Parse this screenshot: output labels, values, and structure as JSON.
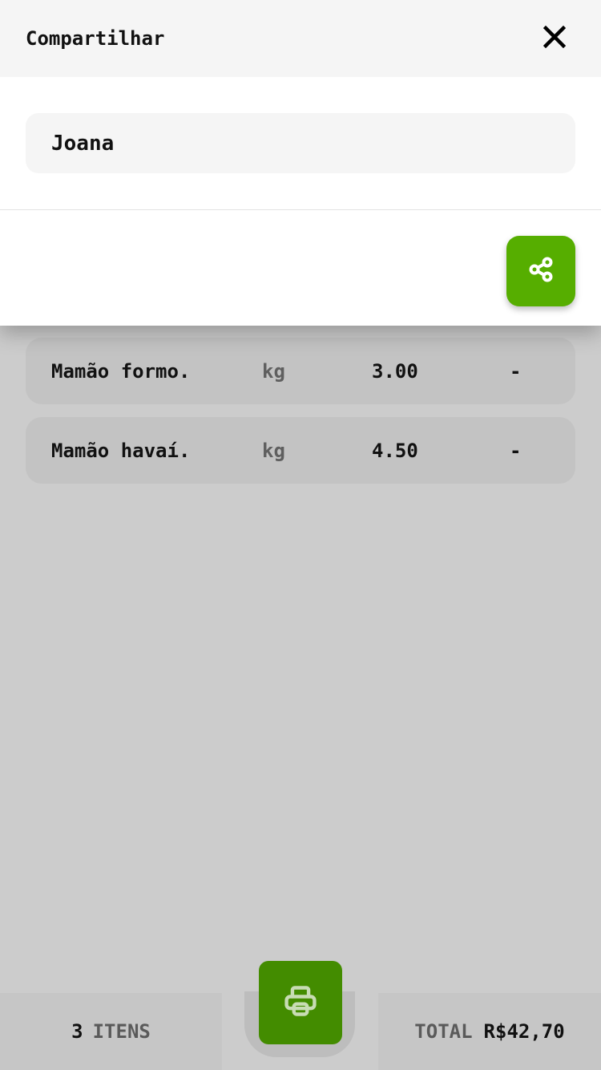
{
  "sheet": {
    "title": "Compartilhar",
    "close_icon": "close-icon",
    "name_input_value": "Joana",
    "share_icon": "share-icon",
    "accent_color": "#56ae00"
  },
  "items": [
    {
      "name": "Mamão formo.",
      "unit": "kg",
      "qty": "3.00",
      "price": "-"
    },
    {
      "name": "Mamão havaí.",
      "unit": "kg",
      "qty": "4.50",
      "price": "-"
    }
  ],
  "footer": {
    "count": "3",
    "count_label": "ITENS",
    "total_label": "TOTAL",
    "total_value": "R$42,70",
    "print_icon": "printer-icon",
    "print_color": "#438c00"
  }
}
